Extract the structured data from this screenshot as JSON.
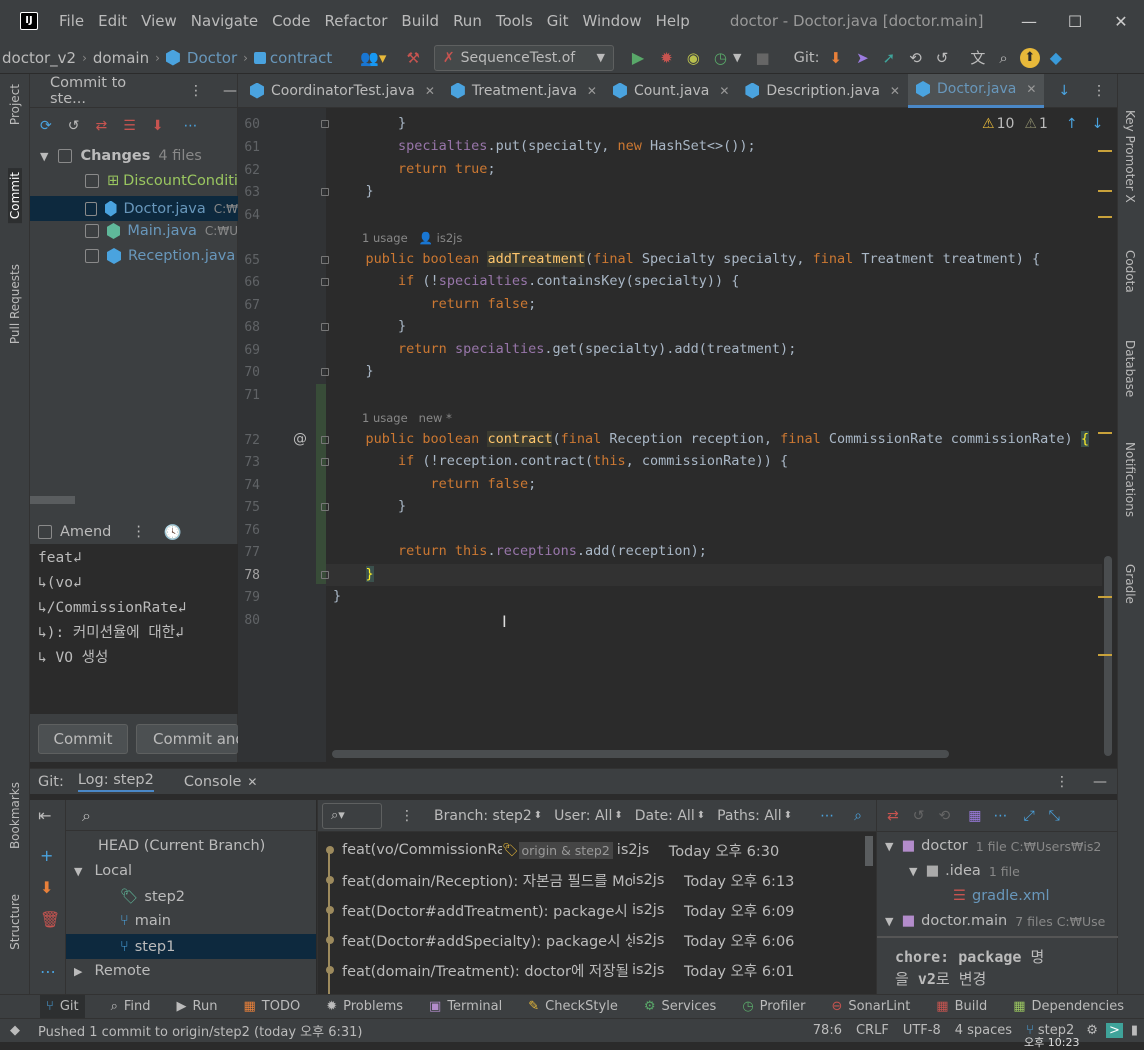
{
  "window": {
    "title": "doctor - Doctor.java [doctor.main]",
    "controls": [
      "—",
      "☐",
      "✕"
    ]
  },
  "menu": [
    "File",
    "Edit",
    "View",
    "Navigate",
    "Code",
    "Refactor",
    "Build",
    "Run",
    "Tools",
    "Git",
    "Window",
    "Help"
  ],
  "breadcrumb": {
    "project": "doctor_v2",
    "module": "domain",
    "class": "Doctor",
    "method": "contract"
  },
  "run_config": "SequenceTest.of",
  "git_label": "Git:",
  "left_strip": [
    "Project",
    "Commit",
    "Pull Requests",
    "Bookmarks",
    "Structure"
  ],
  "right_strip": [
    "Key Promoter X",
    "Codota",
    "Database",
    "Notifications",
    "Gradle"
  ],
  "commit_panel": {
    "title": "Commit to ste...",
    "changes_label": "Changes",
    "changes_count": "4 files",
    "files": [
      {
        "name": "DiscountConditi",
        "path": "",
        "color": "#9ac660"
      },
      {
        "name": "Doctor.java",
        "path": "C:₩",
        "color": "#6897bb"
      },
      {
        "name": "Main.java",
        "path": "C:₩U",
        "color": "#6897bb"
      },
      {
        "name": "Reception.java",
        "path": "",
        "color": "#6897bb"
      }
    ],
    "amend_label": "Amend",
    "message_lines": [
      "feat↲",
      "↳(vo↲",
      "↳/CommissionRate↲",
      "↳): 커미션율에 대한↲",
      "↳ VO 생성"
    ],
    "commit_button": "Commit",
    "commit_push_button": "Commit and"
  },
  "tabs": [
    {
      "name": "CoordinatorTest.java",
      "active": false
    },
    {
      "name": "Treatment.java",
      "active": false
    },
    {
      "name": "Count.java",
      "active": false
    },
    {
      "name": "Description.java",
      "active": false
    },
    {
      "name": "Doctor.java",
      "active": true
    }
  ],
  "inspections": {
    "warnings": "10",
    "weak": "1"
  },
  "code": {
    "line_numbers": [
      "60",
      "61",
      "62",
      "63",
      "64",
      "65",
      "66",
      "67",
      "68",
      "69",
      "70",
      "71",
      "72",
      "73",
      "74",
      "75",
      "76",
      "77",
      "78",
      "79",
      "80"
    ],
    "hint1_usage": "1 usage",
    "hint1_author": "is2js",
    "hint2_usage": "1 usage",
    "hint2_author": "new *",
    "gutter_mark": "@"
  },
  "bottom_panel": {
    "git_label": "Git:",
    "tabs": [
      "Log: step2",
      "Console"
    ],
    "filters": {
      "branch": "Branch: step2",
      "user": "User: All",
      "date": "Date: All",
      "paths": "Paths: All"
    },
    "tree": {
      "head": "HEAD (Current Branch)",
      "local": "Local",
      "branches": [
        "step2",
        "main",
        "step1"
      ],
      "remote": "Remote"
    },
    "commits": [
      {
        "msg": "feat(vo/CommissionRat",
        "tags": "origin & step2",
        "author": "is2js",
        "date": "Today 오후 6:30"
      },
      {
        "msg": "feat(domain/Reception): 자본금 필드를 Mo",
        "tags": "",
        "author": "is2js",
        "date": "Today 오후 6:13"
      },
      {
        "msg": "feat(Doctor#addTreatment): package시 생",
        "tags": "",
        "author": "is2js",
        "date": "Today 오후 6:09"
      },
      {
        "msg": "feat(Doctor#addSpecialty): package시 생성",
        "tags": "",
        "author": "is2js",
        "date": "Today 오후 6:06"
      },
      {
        "msg": "feat(domain/Treatment): doctor에 저장될 |",
        "tags": "",
        "author": "is2js",
        "date": "Today 오후 6:01"
      }
    ],
    "detail": {
      "root": "doctor",
      "root_meta": "1 file  C:₩Users₩is2",
      "idea": ".idea",
      "idea_meta": "1 file",
      "file": "gradle.xml",
      "main": "doctor.main",
      "main_meta": "7 files  C:₩Use",
      "message_bold": "chore: package",
      "message_rest": " 명",
      "message2_a": "을 ",
      "message2_bold": "v2",
      "message2_b": "로 변경"
    }
  },
  "tool_windows": [
    "Git",
    "Find",
    "Run",
    "TODO",
    "Problems",
    "Terminal",
    "CheckStyle",
    "Services",
    "Profiler",
    "SonarLint",
    "Build",
    "Dependencies"
  ],
  "status": {
    "message": "Pushed 1 commit to origin/step2 (today 오후 6:31)",
    "position": "78:6",
    "line_sep": "CRLF",
    "encoding": "UTF-8",
    "indent": "4 spaces",
    "branch": "step2",
    "clock": "오후 10:23"
  }
}
